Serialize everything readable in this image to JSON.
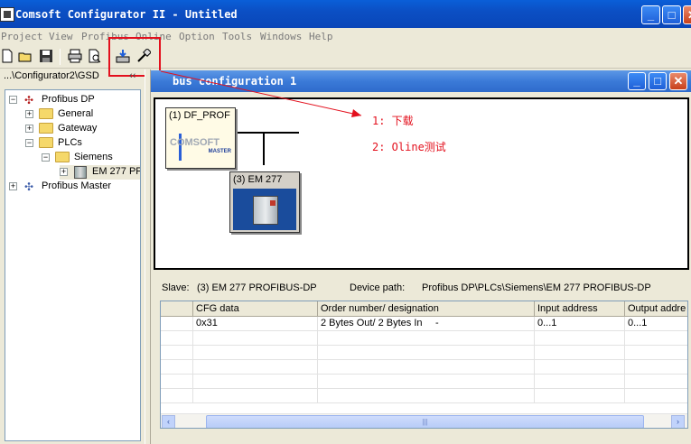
{
  "window": {
    "title": "Comsoft Configurator II - Untitled",
    "minimize": "_",
    "maximize": "□",
    "close": "✕"
  },
  "menu": [
    "Project",
    "View",
    "Profibus",
    "Online",
    "Tools",
    "Windows",
    "Help"
  ],
  "menu_option": "Option",
  "toolbar": {
    "icons": [
      "new-icon",
      "open-icon",
      "save-icon",
      "print-icon",
      "print-preview-icon",
      "download-icon",
      "online-test-icon"
    ]
  },
  "left_panel": {
    "path": "...\\Configurator2\\GSD",
    "chevron": "‹‹",
    "tree": [
      {
        "label": "Profibus DP",
        "expander": "−",
        "icon": "network-icon"
      },
      {
        "label": "General",
        "expander": "+",
        "icon": "folder-icon"
      },
      {
        "label": "Gateway",
        "expander": "+",
        "icon": "folder-icon"
      },
      {
        "label": "PLCs",
        "expander": "−",
        "icon": "folder-icon"
      },
      {
        "label": "Siemens",
        "expander": "−",
        "icon": "folder-icon"
      },
      {
        "label": "EM 277 PF",
        "expander": "+",
        "icon": "device-icon"
      },
      {
        "label": "Profibus Master",
        "expander": "+",
        "icon": "network-icon"
      }
    ]
  },
  "child_window": {
    "title": "bus configuration 1",
    "master": {
      "label": "(1) DF_PROF",
      "logo_text": "COMSOFT",
      "logo_sub": "MASTER"
    },
    "slave": {
      "label": "(3) EM 277"
    }
  },
  "annotations": {
    "step1": "1: 下载",
    "step2": "2: Oline测试"
  },
  "slave_info": {
    "slave_label": "Slave:",
    "slave_value": "(3) EM 277 PROFIBUS-DP",
    "path_label": "Device path:",
    "path_value": "Profibus DP\\PLCs\\Siemens\\EM 277 PROFIBUS-DP"
  },
  "table": {
    "headers": [
      "CFG data",
      "Order number/ designation",
      "Input address",
      "Output addre"
    ],
    "rows": [
      [
        "0x31",
        "2 Bytes Out/ 2 Bytes In",
        "-",
        "0...1",
        "0...1"
      ]
    ],
    "scroll_left": "‹",
    "scroll_right": "›",
    "scroll_grip": "|||"
  },
  "colors": {
    "title_blue": "#0a5fd8",
    "highlight_red": "#e3101d"
  }
}
